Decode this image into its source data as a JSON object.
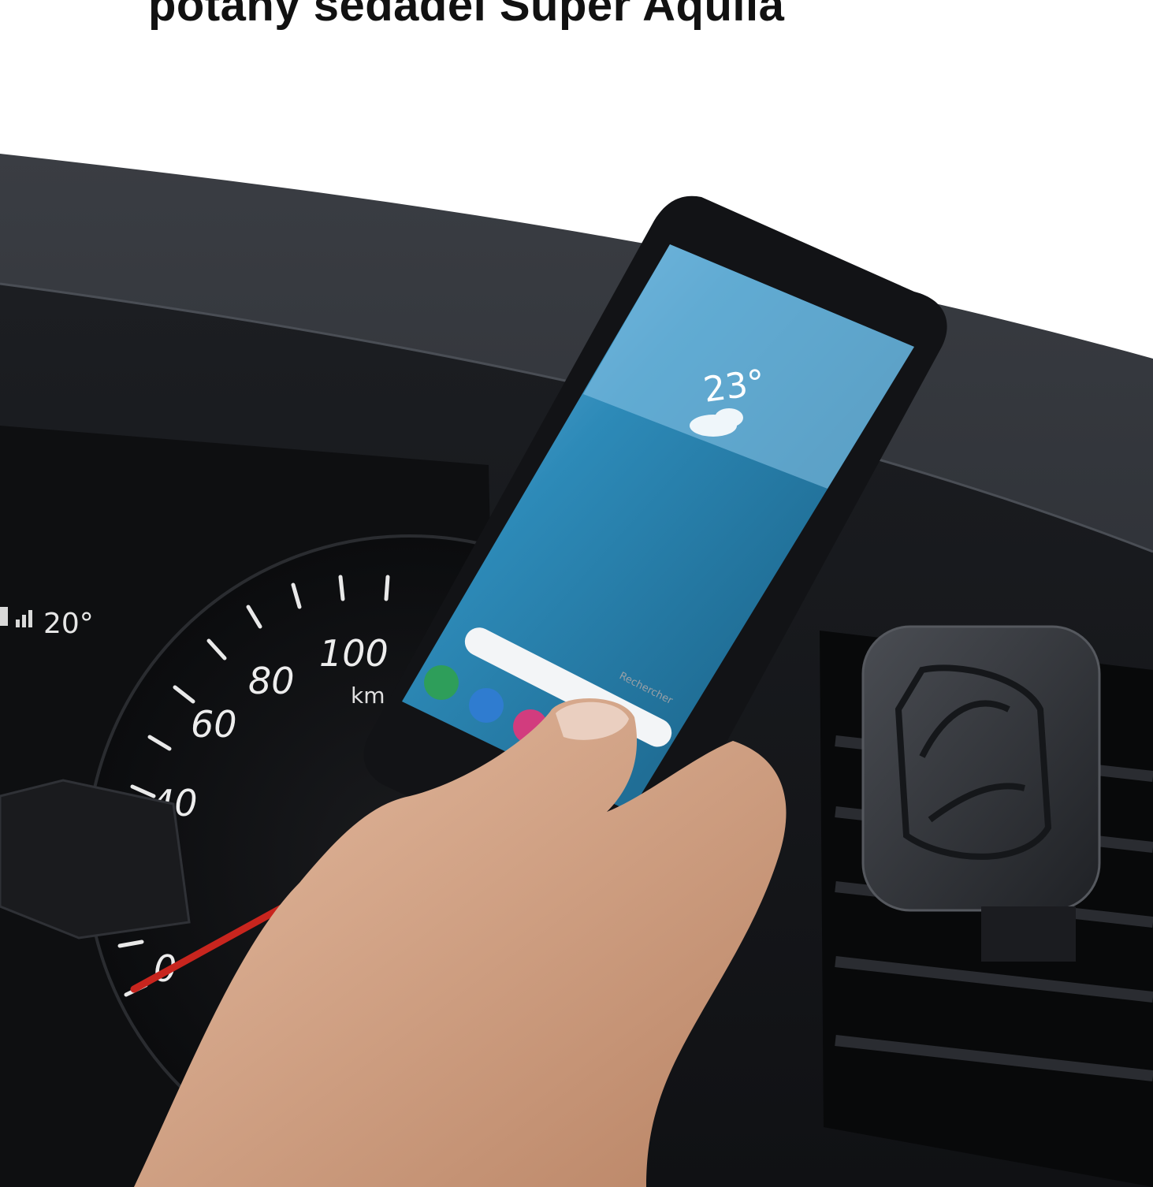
{
  "headline": "potahy sedadel Super Aquila",
  "dashboard": {
    "status_readout": "20°",
    "speedometer": {
      "tick_labels": [
        "0",
        "40",
        "60",
        "80",
        "100"
      ],
      "unit": "km"
    }
  },
  "phone": {
    "weather_temp": "23°",
    "search_placeholder": "Rechercher"
  },
  "colors": {
    "page_background": "#ffffff",
    "dashboard": "#1b1d21",
    "phone_screen": "#1f6f98",
    "needle": "#c8251e",
    "skin": "#d8a98a"
  },
  "icons": [
    "phone-app-icon",
    "messages-app-icon",
    "gallery-app-icon",
    "magnetic-mount-logo-icon"
  ]
}
